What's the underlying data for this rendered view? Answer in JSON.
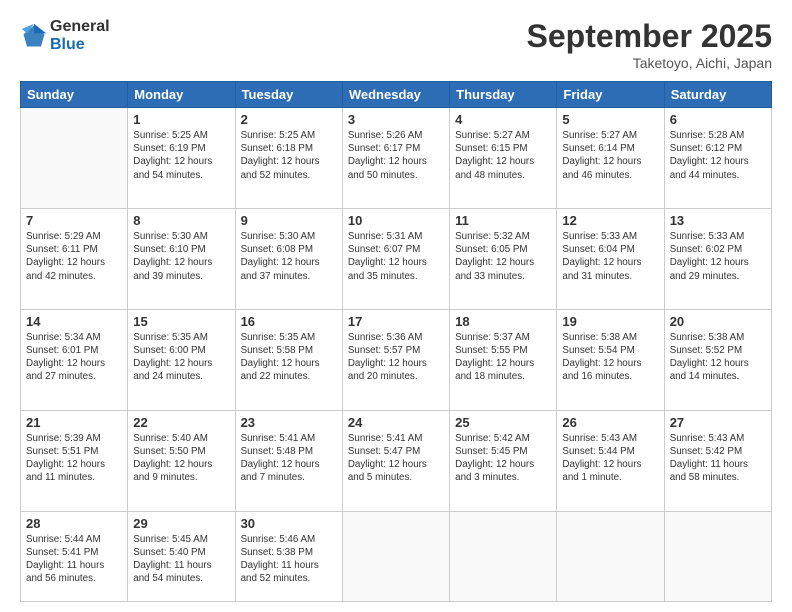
{
  "logo": {
    "general": "General",
    "blue": "Blue"
  },
  "header": {
    "month_year": "September 2025",
    "location": "Taketoyo, Aichi, Japan"
  },
  "weekdays": [
    "Sunday",
    "Monday",
    "Tuesday",
    "Wednesday",
    "Thursday",
    "Friday",
    "Saturday"
  ],
  "weeks": [
    [
      {
        "day": null,
        "text": ""
      },
      {
        "day": "1",
        "text": "Sunrise: 5:25 AM\nSunset: 6:19 PM\nDaylight: 12 hours\nand 54 minutes."
      },
      {
        "day": "2",
        "text": "Sunrise: 5:25 AM\nSunset: 6:18 PM\nDaylight: 12 hours\nand 52 minutes."
      },
      {
        "day": "3",
        "text": "Sunrise: 5:26 AM\nSunset: 6:17 PM\nDaylight: 12 hours\nand 50 minutes."
      },
      {
        "day": "4",
        "text": "Sunrise: 5:27 AM\nSunset: 6:15 PM\nDaylight: 12 hours\nand 48 minutes."
      },
      {
        "day": "5",
        "text": "Sunrise: 5:27 AM\nSunset: 6:14 PM\nDaylight: 12 hours\nand 46 minutes."
      },
      {
        "day": "6",
        "text": "Sunrise: 5:28 AM\nSunset: 6:12 PM\nDaylight: 12 hours\nand 44 minutes."
      }
    ],
    [
      {
        "day": "7",
        "text": "Sunrise: 5:29 AM\nSunset: 6:11 PM\nDaylight: 12 hours\nand 42 minutes."
      },
      {
        "day": "8",
        "text": "Sunrise: 5:30 AM\nSunset: 6:10 PM\nDaylight: 12 hours\nand 39 minutes."
      },
      {
        "day": "9",
        "text": "Sunrise: 5:30 AM\nSunset: 6:08 PM\nDaylight: 12 hours\nand 37 minutes."
      },
      {
        "day": "10",
        "text": "Sunrise: 5:31 AM\nSunset: 6:07 PM\nDaylight: 12 hours\nand 35 minutes."
      },
      {
        "day": "11",
        "text": "Sunrise: 5:32 AM\nSunset: 6:05 PM\nDaylight: 12 hours\nand 33 minutes."
      },
      {
        "day": "12",
        "text": "Sunrise: 5:33 AM\nSunset: 6:04 PM\nDaylight: 12 hours\nand 31 minutes."
      },
      {
        "day": "13",
        "text": "Sunrise: 5:33 AM\nSunset: 6:02 PM\nDaylight: 12 hours\nand 29 minutes."
      }
    ],
    [
      {
        "day": "14",
        "text": "Sunrise: 5:34 AM\nSunset: 6:01 PM\nDaylight: 12 hours\nand 27 minutes."
      },
      {
        "day": "15",
        "text": "Sunrise: 5:35 AM\nSunset: 6:00 PM\nDaylight: 12 hours\nand 24 minutes."
      },
      {
        "day": "16",
        "text": "Sunrise: 5:35 AM\nSunset: 5:58 PM\nDaylight: 12 hours\nand 22 minutes."
      },
      {
        "day": "17",
        "text": "Sunrise: 5:36 AM\nSunset: 5:57 PM\nDaylight: 12 hours\nand 20 minutes."
      },
      {
        "day": "18",
        "text": "Sunrise: 5:37 AM\nSunset: 5:55 PM\nDaylight: 12 hours\nand 18 minutes."
      },
      {
        "day": "19",
        "text": "Sunrise: 5:38 AM\nSunset: 5:54 PM\nDaylight: 12 hours\nand 16 minutes."
      },
      {
        "day": "20",
        "text": "Sunrise: 5:38 AM\nSunset: 5:52 PM\nDaylight: 12 hours\nand 14 minutes."
      }
    ],
    [
      {
        "day": "21",
        "text": "Sunrise: 5:39 AM\nSunset: 5:51 PM\nDaylight: 12 hours\nand 11 minutes."
      },
      {
        "day": "22",
        "text": "Sunrise: 5:40 AM\nSunset: 5:50 PM\nDaylight: 12 hours\nand 9 minutes."
      },
      {
        "day": "23",
        "text": "Sunrise: 5:41 AM\nSunset: 5:48 PM\nDaylight: 12 hours\nand 7 minutes."
      },
      {
        "day": "24",
        "text": "Sunrise: 5:41 AM\nSunset: 5:47 PM\nDaylight: 12 hours\nand 5 minutes."
      },
      {
        "day": "25",
        "text": "Sunrise: 5:42 AM\nSunset: 5:45 PM\nDaylight: 12 hours\nand 3 minutes."
      },
      {
        "day": "26",
        "text": "Sunrise: 5:43 AM\nSunset: 5:44 PM\nDaylight: 12 hours\nand 1 minute."
      },
      {
        "day": "27",
        "text": "Sunrise: 5:43 AM\nSunset: 5:42 PM\nDaylight: 11 hours\nand 58 minutes."
      }
    ],
    [
      {
        "day": "28",
        "text": "Sunrise: 5:44 AM\nSunset: 5:41 PM\nDaylight: 11 hours\nand 56 minutes."
      },
      {
        "day": "29",
        "text": "Sunrise: 5:45 AM\nSunset: 5:40 PM\nDaylight: 11 hours\nand 54 minutes."
      },
      {
        "day": "30",
        "text": "Sunrise: 5:46 AM\nSunset: 5:38 PM\nDaylight: 11 hours\nand 52 minutes."
      },
      {
        "day": null,
        "text": ""
      },
      {
        "day": null,
        "text": ""
      },
      {
        "day": null,
        "text": ""
      },
      {
        "day": null,
        "text": ""
      }
    ]
  ]
}
